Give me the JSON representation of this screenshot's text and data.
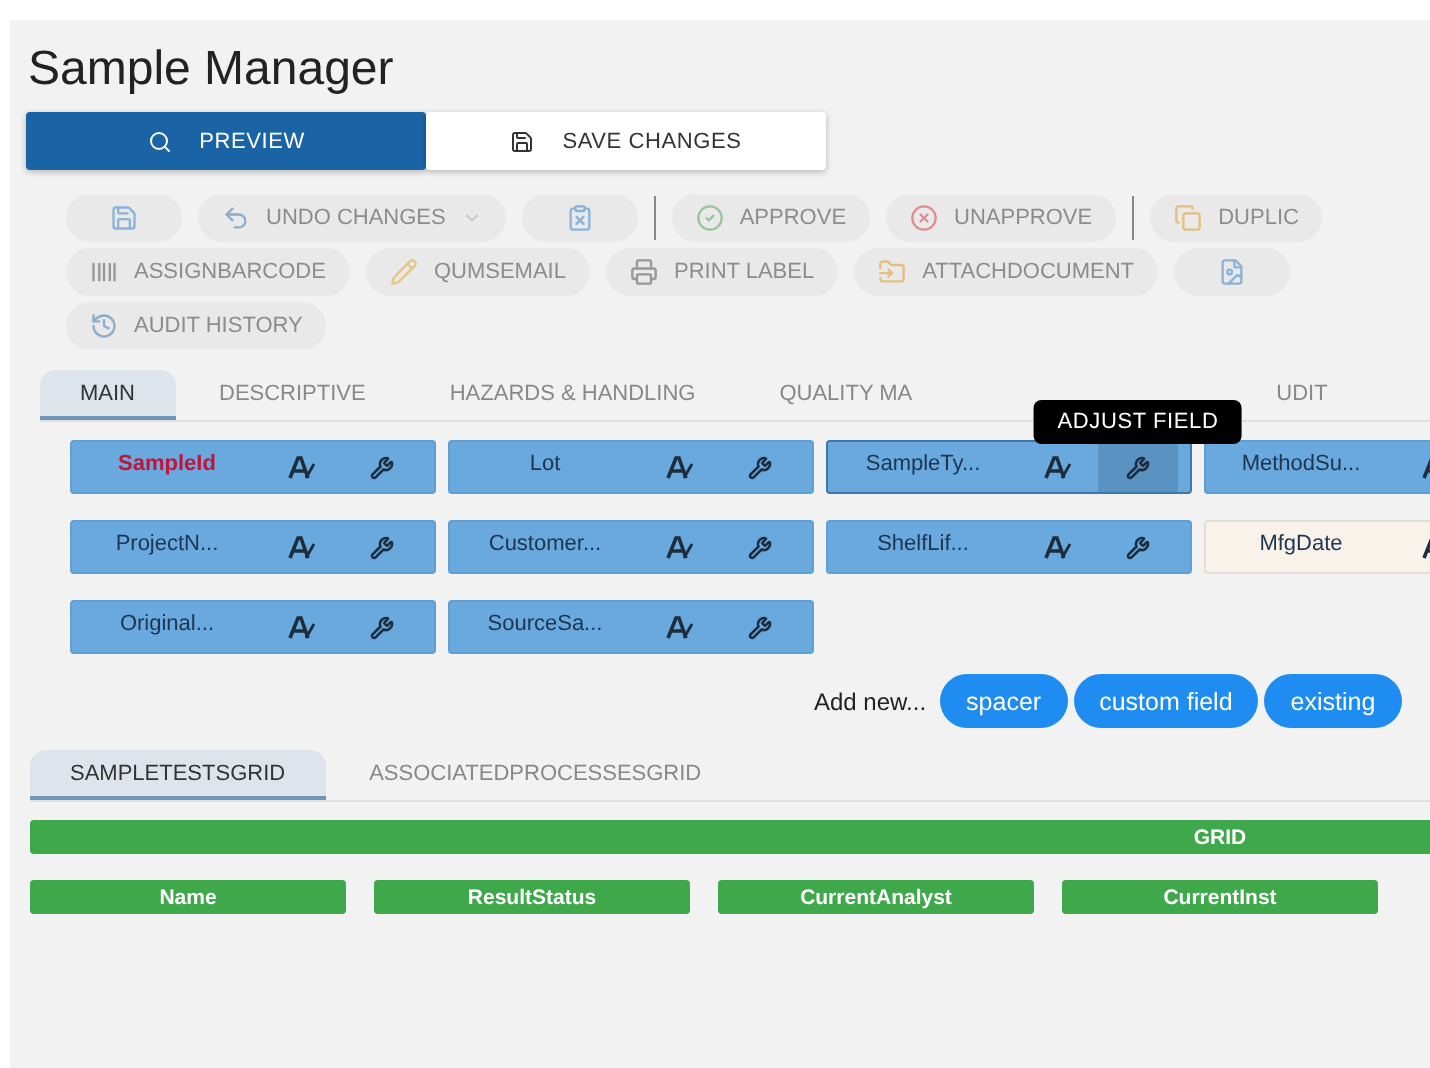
{
  "title": "Sample Manager",
  "mode_tabs": [
    {
      "label": "PREVIEW",
      "selected": true
    },
    {
      "label": "SAVE CHANGES",
      "selected": false
    }
  ],
  "toolbar": [
    [
      {
        "kind": "icon",
        "disabled": true
      },
      {
        "kind": "dropdown",
        "label": "UNDO CHANGES",
        "disabled": true
      },
      {
        "kind": "icon",
        "disabled": true
      },
      {
        "kind": "separator"
      },
      {
        "kind": "button",
        "label": "APPROVE",
        "disabled": true
      },
      {
        "kind": "button",
        "label": "UNAPPROVE",
        "disabled": true
      },
      {
        "kind": "separator"
      },
      {
        "kind": "button",
        "label": "DUPLIC",
        "disabled": true
      }
    ],
    [
      {
        "kind": "button",
        "label": "ASSIGNBARCODE",
        "disabled": true
      },
      {
        "kind": "button",
        "label": "QUMSEMAIL",
        "disabled": true
      },
      {
        "kind": "button",
        "label": "PRINT LABEL",
        "disabled": true
      },
      {
        "kind": "button",
        "label": "ATTACHDOCUMENT",
        "disabled": true
      },
      {
        "kind": "icon",
        "disabled": true
      }
    ],
    [
      {
        "kind": "button",
        "label": "AUDIT HISTORY",
        "disabled": true
      }
    ]
  ],
  "tabs": [
    {
      "label": "MAIN",
      "selected": true
    },
    {
      "label": "DESCRIPTIVE",
      "selected": false
    },
    {
      "label": "HAZARDS & HANDLING",
      "selected": false
    },
    {
      "label": "QUALITY MA",
      "selected": false
    },
    {
      "label": "UDIT",
      "selected": false
    }
  ],
  "tooltip": "ADJUST FIELD",
  "field_rows": [
    [
      {
        "label": "SampleId",
        "required": true,
        "kind": "field",
        "hover": false
      },
      {
        "label": "Lot",
        "required": false,
        "kind": "field",
        "hover": false
      },
      {
        "label": "SampleTy...",
        "required": false,
        "kind": "field",
        "hover": true
      },
      {
        "label": "MethodSu...",
        "required": false,
        "kind": "clipped",
        "hover": false
      }
    ],
    [
      {
        "label": "ProjectN...",
        "required": false,
        "kind": "field",
        "hover": false
      },
      {
        "label": "Customer...",
        "required": false,
        "kind": "field",
        "hover": false
      },
      {
        "label": "ShelfLif...",
        "required": false,
        "kind": "field",
        "hover": false
      },
      {
        "label": "MfgDate",
        "required": false,
        "kind": "readonly",
        "hover": false
      }
    ],
    [
      {
        "label": "Original...",
        "required": false,
        "kind": "field",
        "hover": false
      },
      {
        "label": "SourceSa...",
        "required": false,
        "kind": "field",
        "hover": false
      }
    ]
  ],
  "add_new": {
    "label": "Add new...",
    "buttons": [
      "spacer",
      "custom field",
      "existing"
    ]
  },
  "grid_tabs": [
    {
      "label": "SAMPLETESTSGRID",
      "selected": true
    },
    {
      "label": "ASSOCIATEDPROCESSESGRID",
      "selected": false
    }
  ],
  "grid": {
    "title": "GRID",
    "columns": [
      "Name",
      "ResultStatus",
      "CurrentAnalyst",
      "CurrentInst"
    ]
  }
}
